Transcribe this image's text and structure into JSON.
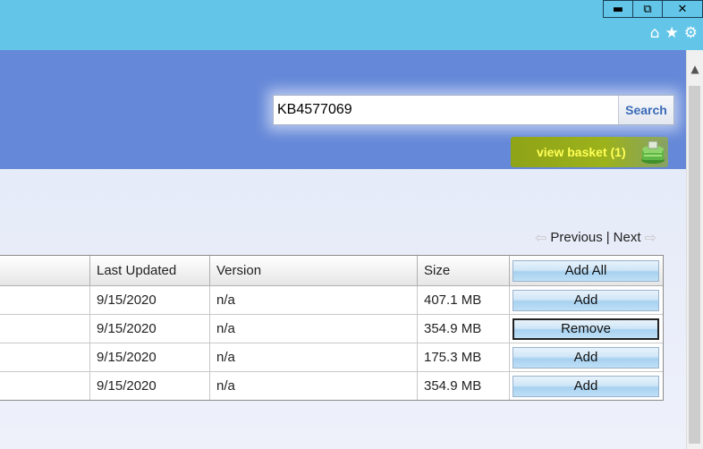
{
  "window": {
    "minimize_icon": "minimize-icon",
    "restore_icon": "restore-icon",
    "close_icon": "close-icon"
  },
  "toolbar": {
    "icons": [
      "home-icon",
      "star-icon",
      "gear-icon"
    ]
  },
  "search": {
    "value": "KB4577069",
    "button_label": "Search"
  },
  "basket": {
    "label": "view basket (1)"
  },
  "pager": {
    "previous": "Previous",
    "separator": "|",
    "next": "Next"
  },
  "table": {
    "headers": [
      "",
      "Last Updated",
      "Version",
      "Size",
      "Add All"
    ],
    "rows": [
      {
        "last_updated": "9/15/2020",
        "version": "n/a",
        "size": "407.1 MB",
        "action": "Add"
      },
      {
        "last_updated": "9/15/2020",
        "version": "n/a",
        "size": "354.9 MB",
        "action": "Remove"
      },
      {
        "last_updated": "9/15/2020",
        "version": "n/a",
        "size": "175.3 MB",
        "action": "Add"
      },
      {
        "last_updated": "9/15/2020",
        "version": "n/a",
        "size": "354.9 MB",
        "action": "Add"
      }
    ]
  },
  "colors": {
    "chrome": "#63c6e8",
    "banner": "#6588d8",
    "basket": "#9cb21b",
    "basket_text": "#ffff55"
  }
}
